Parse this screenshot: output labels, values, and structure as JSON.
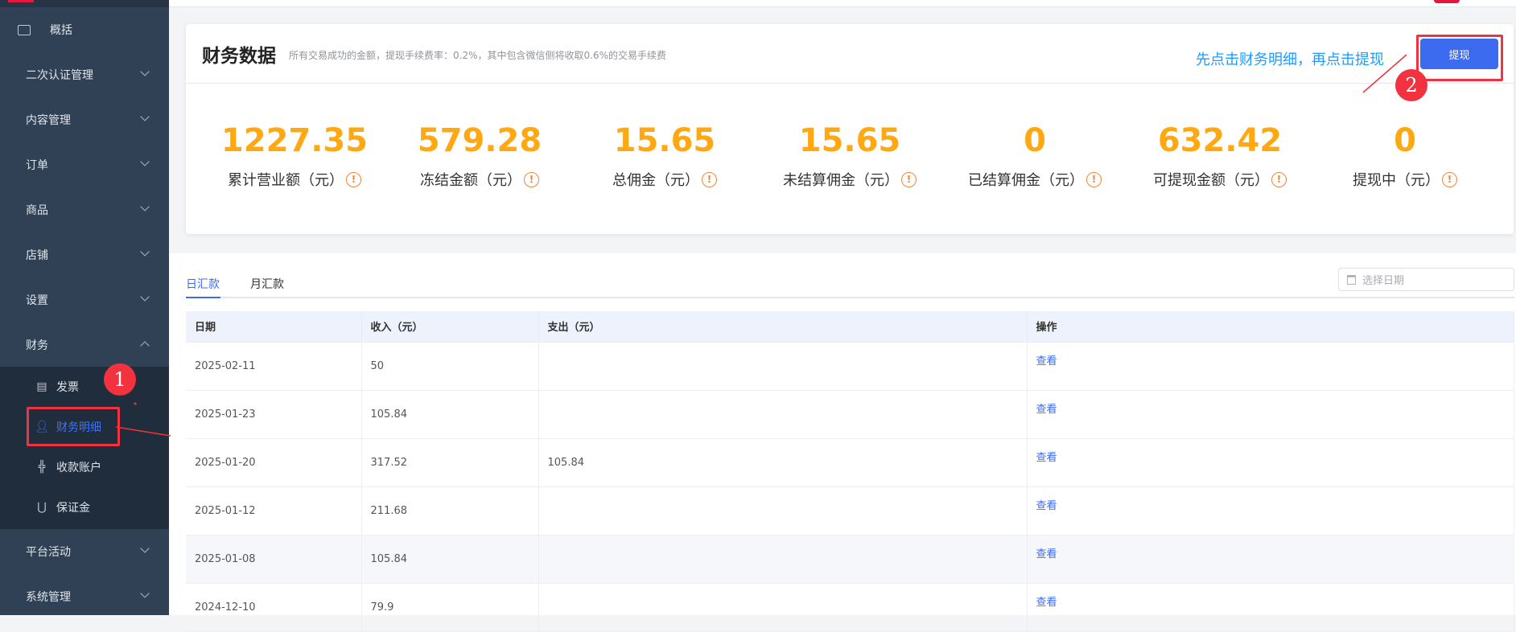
{
  "sidebar": {
    "items": [
      {
        "label": "概括",
        "icon": "monitor-icon"
      },
      {
        "label": "二次认证管理"
      },
      {
        "label": "内容管理"
      },
      {
        "label": "订单"
      },
      {
        "label": "商品"
      },
      {
        "label": "店铺"
      },
      {
        "label": "设置"
      },
      {
        "label": "财务",
        "expanded": true
      },
      {
        "label": "平台活动"
      },
      {
        "label": "系统管理"
      }
    ],
    "sub_items": [
      {
        "label": "发票",
        "icon": "document-icon"
      },
      {
        "label": "财务明细",
        "icon": "user-icon",
        "active": true
      },
      {
        "label": "收款账户",
        "icon": "collapse-icon"
      },
      {
        "label": "保证金",
        "icon": "magnet-icon"
      }
    ]
  },
  "finance": {
    "title": "财务数据",
    "subtitle": "所有交易成功的金额，提现手续费率：0.2%，其中包含微信侧将收取0.6%的交易手续费",
    "withdraw_label": "提现",
    "stats": [
      {
        "value": "1227.35",
        "label": "累计营业额（元）"
      },
      {
        "value": "579.28",
        "label": "冻结金额（元）"
      },
      {
        "value": "15.65",
        "label": "总佣金（元）"
      },
      {
        "value": "15.65",
        "label": "未结算佣金（元）"
      },
      {
        "value": "0",
        "label": "已结算佣金（元）"
      },
      {
        "value": "632.42",
        "label": "可提现金额（元）"
      },
      {
        "value": "0",
        "label": "提现中（元）"
      }
    ],
    "warn_glyph": "!"
  },
  "annotations": {
    "hint": "先点击财务明细，再点击提现",
    "step1": "1",
    "step2": "2",
    "color": "#f2333f"
  },
  "tabs": [
    {
      "label": "日汇款",
      "active": true
    },
    {
      "label": "月汇款"
    }
  ],
  "date_picker": {
    "placeholder": "选择日期"
  },
  "table": {
    "columns": [
      "日期",
      "收入（元）",
      "支出（元）",
      "操作"
    ],
    "rows": [
      {
        "date": "2025-02-11",
        "income": "50",
        "expense": "",
        "action": "查看"
      },
      {
        "date": "2025-01-23",
        "income": "105.84",
        "expense": "",
        "action": "查看"
      },
      {
        "date": "2025-01-20",
        "income": "317.52",
        "expense": "105.84",
        "action": "查看"
      },
      {
        "date": "2025-01-12",
        "income": "211.68",
        "expense": "",
        "action": "查看"
      },
      {
        "date": "2025-01-08",
        "income": "105.84",
        "expense": "",
        "action": "查看"
      },
      {
        "date": "2024-12-10",
        "income": "79.9",
        "expense": "",
        "action": "查看"
      }
    ]
  },
  "colors": {
    "accent": "#3d6bef",
    "amount": "#ffa812",
    "sidebar": "#304156"
  }
}
